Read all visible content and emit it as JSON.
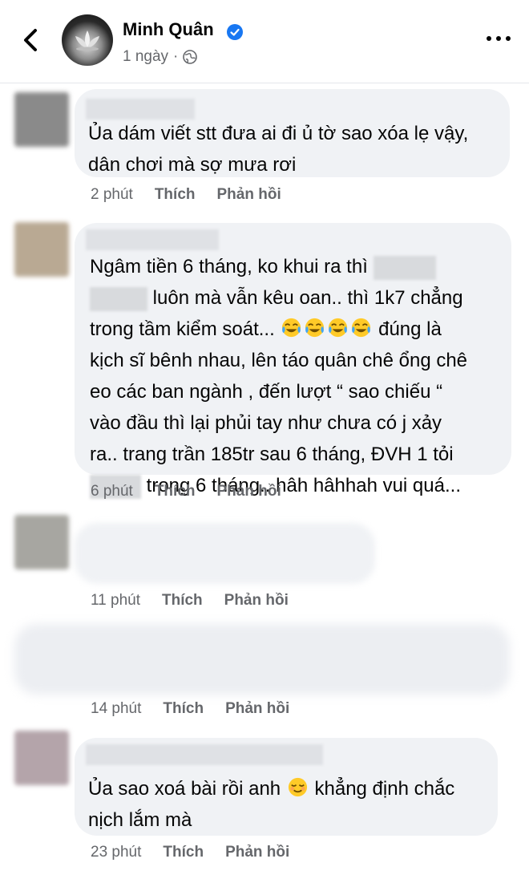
{
  "header": {
    "back_icon": "chevron-left-icon",
    "name": "Minh Quân",
    "verified_icon": "verified-badge-icon",
    "verified_color": "#1877f2",
    "time": "1 ngày",
    "separator": "·",
    "audience_icon": "globe-icon",
    "more_icon": "more-horizontal-icon"
  },
  "comments": [
    {
      "lines": [
        "Ủa dám viết stt đưa ai đi ủ tờ sao xóa lẹ vậy,",
        "dân chơi mà sợ mưa rơi"
      ],
      "time": "2 phút",
      "like": "Thích",
      "reply": "Phản hồi"
    },
    {
      "line1": "Ngâm tiền 6 tháng, ko khui ra thì",
      "line2": "luôn mà vẫn kêu oan.. thì 1k7 chẳng",
      "line3a": "trong tầm kiểm soát...",
      "line3b": "đúng là",
      "line4": "kịch sĩ bênh nhau, lên táo quân chê ổng chê",
      "line5": "eo các ban ngành , đến lượt “ sao chiếu “",
      "line6": "vào đầu thì lại phủi tay như chưa có j xảy",
      "line7": "ra.. trang trần 185tr sau 6 tháng, ĐVH 1 tỏi",
      "line8": "trong 6 tháng.. hâh hâhhah vui quá...",
      "emoji": "tears-of-joy-emoji",
      "time": "6 phút",
      "like": "Thích",
      "reply": "Phản hồi"
    },
    {
      "time": "11 phút",
      "like": "Thích",
      "reply": "Phản hồi"
    },
    {
      "time": "14 phút",
      "like": "Thích",
      "reply": "Phản hồi"
    },
    {
      "line1a": "Ủa sao xoá bài rồi anh",
      "line1b": "khẳng định chắc",
      "line2": "nịch lắm mà",
      "emoji": "relieved-face-emoji",
      "time": "23 phút",
      "like": "Thích",
      "reply": "Phản hồi"
    }
  ]
}
